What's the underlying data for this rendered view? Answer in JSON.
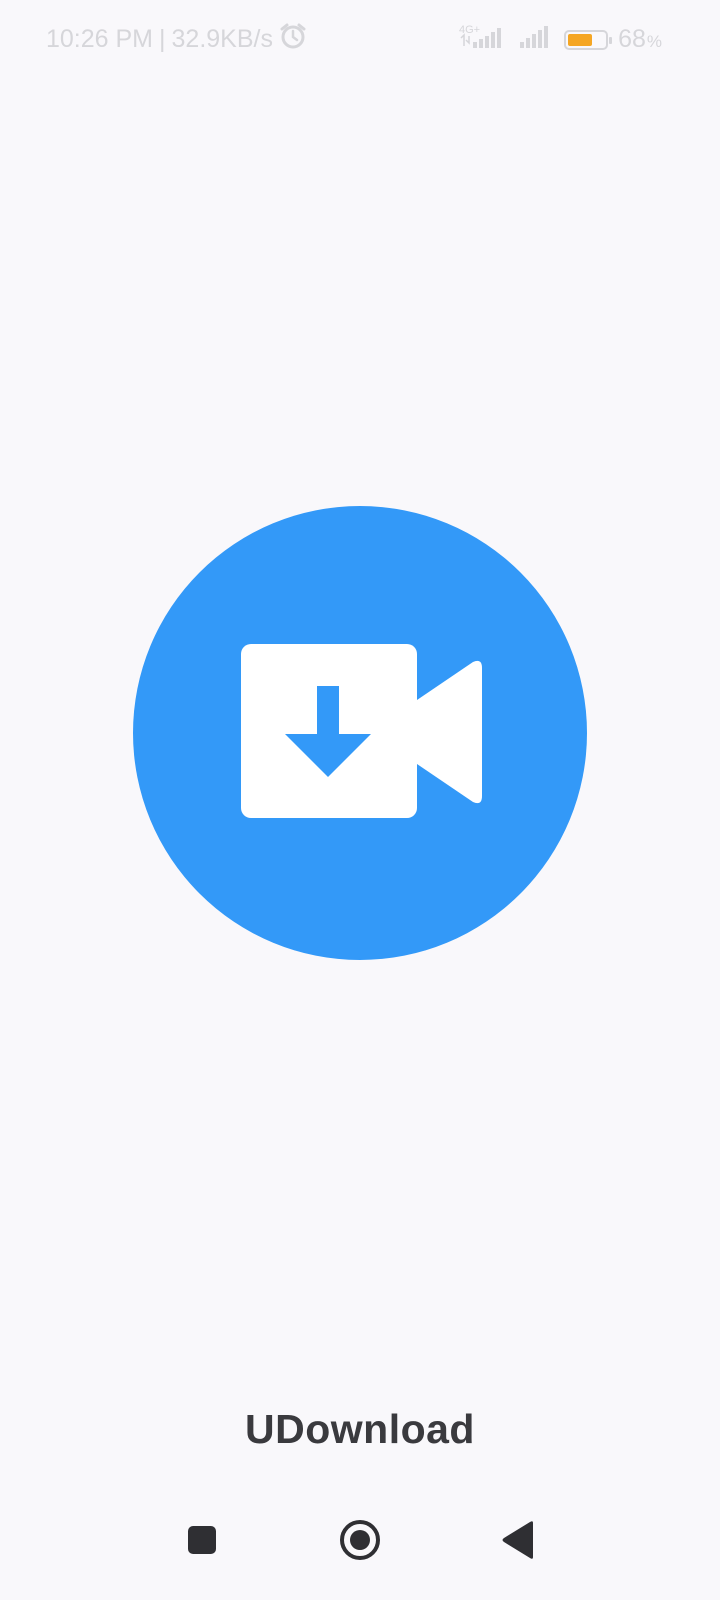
{
  "status_bar": {
    "time": "10:26 PM",
    "separator": "|",
    "network_speed": "32.9KB/s",
    "network_type": "4G+",
    "battery_percent": "68",
    "battery_percent_sign": "%",
    "battery_level": 0.68,
    "icons": [
      "alarm-icon",
      "signal-4g-icon",
      "signal-icon",
      "battery-icon"
    ]
  },
  "splash": {
    "logo_icon": "video-download-icon",
    "app_name": "UDownload"
  },
  "nav_bar": {
    "icons": [
      "recents-square-icon",
      "home-circle-icon",
      "back-triangle-icon"
    ]
  },
  "colors": {
    "background": "#f9f8fb",
    "accent": "#3399f8",
    "status_text": "#d6d6da",
    "battery_fill": "#f5a623",
    "title_text": "#3a3a3e",
    "nav_icon": "#2f2f33"
  }
}
